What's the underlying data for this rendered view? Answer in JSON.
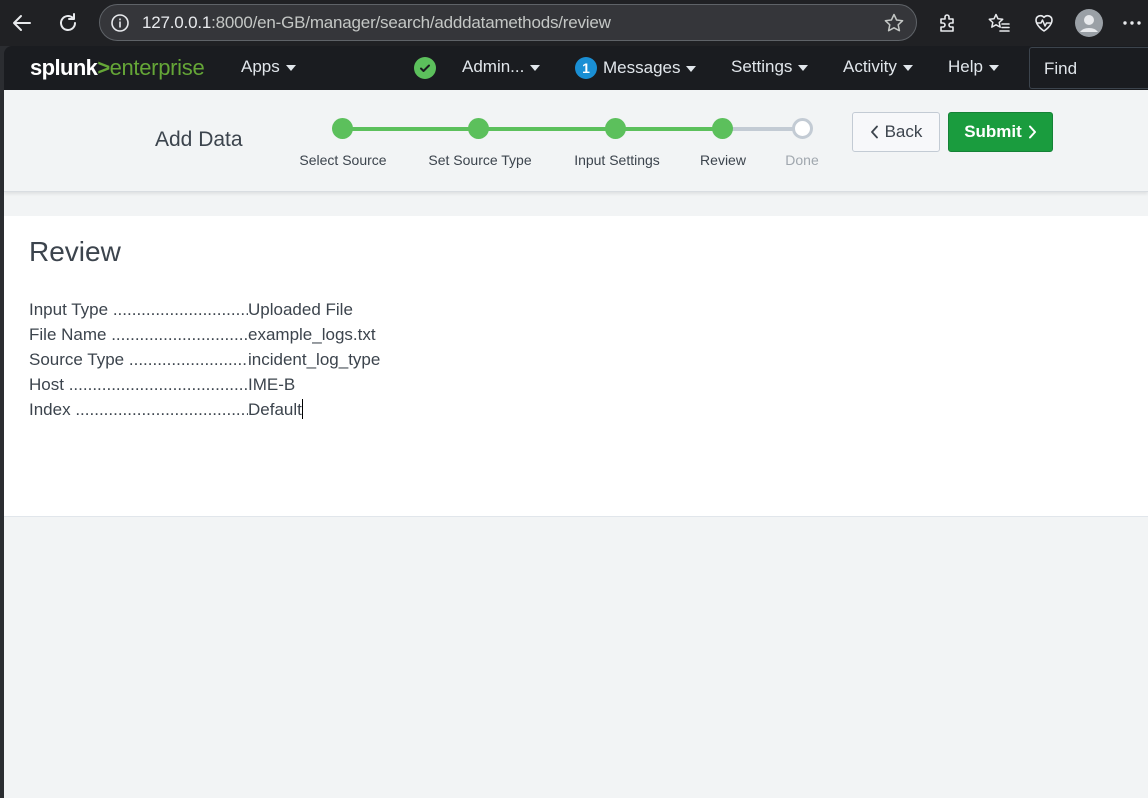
{
  "browser": {
    "url_host": "127.0.0.1",
    "url_path": ":8000/en-GB/manager/search/adddatamethods/review"
  },
  "nav": {
    "logo_splunk": "splunk",
    "logo_gt": ">",
    "logo_enterprise": "enterprise",
    "apps": "Apps",
    "admin": "Admin...",
    "messages_count": "1",
    "messages": "Messages",
    "settings": "Settings",
    "activity": "Activity",
    "help": "Help",
    "find": "Find"
  },
  "wizard": {
    "title": "Add Data",
    "steps": [
      {
        "label": "Select Source",
        "state": "done"
      },
      {
        "label": "Set Source Type",
        "state": "done"
      },
      {
        "label": "Input Settings",
        "state": "done"
      },
      {
        "label": "Review",
        "state": "done"
      },
      {
        "label": "Done",
        "state": "todo"
      }
    ],
    "back_label": "Back",
    "submit_label": "Submit"
  },
  "review": {
    "title": "Review",
    "rows": [
      {
        "key": "Input Type",
        "value": "Uploaded File"
      },
      {
        "key": "File Name",
        "value": "example_logs.txt"
      },
      {
        "key": "Source Type",
        "value": "incident_log_type"
      },
      {
        "key": "Host",
        "value": "IME-B"
      },
      {
        "key": "Index",
        "value": "Default"
      }
    ]
  },
  "colors": {
    "accent_green": "#5cc05c",
    "submit_green": "#1a9c3e",
    "nav_bg": "#1a1c20"
  }
}
